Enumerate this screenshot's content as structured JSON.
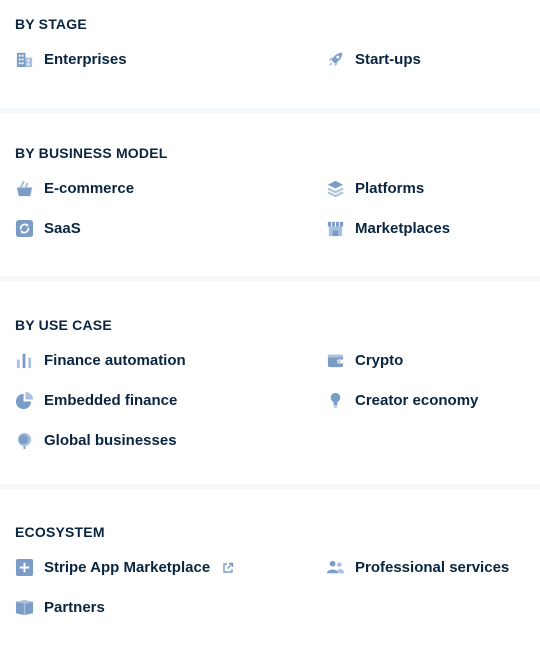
{
  "colors": {
    "icon": "#7a9cc6",
    "icon_dark": "#5d84b8",
    "text": "#0a2540",
    "divider": "#f6f9fc"
  },
  "sections": [
    {
      "title": "BY STAGE",
      "items": [
        {
          "label": "Enterprises",
          "icon": "building-icon"
        },
        {
          "label": "Start-ups",
          "icon": "rocket-icon"
        }
      ]
    },
    {
      "title": "BY BUSINESS MODEL",
      "items": [
        {
          "label": "E-commerce",
          "icon": "basket-icon"
        },
        {
          "label": "Platforms",
          "icon": "layers-icon"
        },
        {
          "label": "SaaS",
          "icon": "refresh-icon"
        },
        {
          "label": "Marketplaces",
          "icon": "storefront-icon"
        }
      ]
    },
    {
      "title": "BY USE CASE",
      "items": [
        {
          "label": "Finance automation",
          "icon": "bar-chart-icon"
        },
        {
          "label": "Crypto",
          "icon": "wallet-icon"
        },
        {
          "label": "Embedded finance",
          "icon": "pie-chart-icon"
        },
        {
          "label": "Creator economy",
          "icon": "lightbulb-icon"
        },
        {
          "label": "Global businesses",
          "icon": "globe-icon"
        }
      ]
    },
    {
      "title": "ECOSYSTEM",
      "items": [
        {
          "label": "Stripe App Marketplace",
          "icon": "plus-square-icon",
          "external": true
        },
        {
          "label": "Professional services",
          "icon": "people-icon"
        },
        {
          "label": "Partners",
          "icon": "book-icon"
        }
      ]
    }
  ]
}
